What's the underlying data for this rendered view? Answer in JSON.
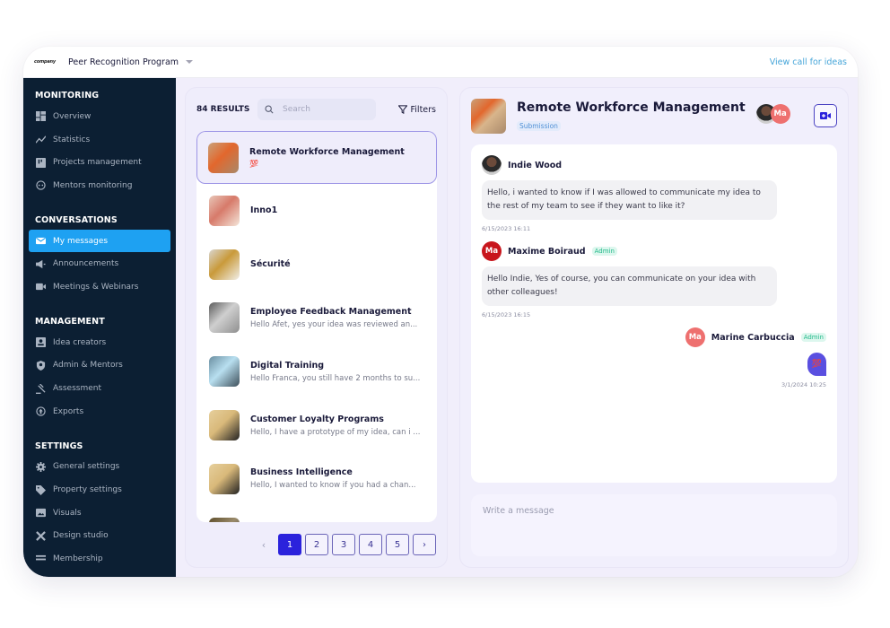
{
  "topbar": {
    "logo_text": "company",
    "program_name": "Peer Recognition Program",
    "view_call_link": "View call for ideas"
  },
  "sidebar": {
    "sections": [
      {
        "title": "MONITORING",
        "items": [
          {
            "label": "Overview",
            "icon": "dashboard-icon"
          },
          {
            "label": "Statistics",
            "icon": "chart-line-icon"
          },
          {
            "label": "Projects management",
            "icon": "kanban-icon"
          },
          {
            "label": "Mentors monitoring",
            "icon": "mentor-face-icon"
          }
        ]
      },
      {
        "title": "CONVERSATIONS",
        "items": [
          {
            "label": "My messages",
            "icon": "envelope-icon",
            "active": true
          },
          {
            "label": "Announcements",
            "icon": "megaphone-icon"
          },
          {
            "label": "Meetings & Webinars",
            "icon": "video-camera-icon"
          }
        ]
      },
      {
        "title": "MANAGEMENT",
        "items": [
          {
            "label": "Idea creators",
            "icon": "user-card-icon"
          },
          {
            "label": "Admin & Mentors",
            "icon": "shield-user-icon"
          },
          {
            "label": "Assessment",
            "icon": "gavel-icon"
          },
          {
            "label": "Exports",
            "icon": "export-circle-icon"
          }
        ]
      },
      {
        "title": "SETTINGS",
        "items": [
          {
            "label": "General settings",
            "icon": "gear-icon"
          },
          {
            "label": "Property settings",
            "icon": "tag-icon"
          },
          {
            "label": "Visuals",
            "icon": "image-icon"
          },
          {
            "label": "Design studio",
            "icon": "design-tools-icon"
          },
          {
            "label": "Membership",
            "icon": "list-icon"
          }
        ]
      }
    ]
  },
  "list_panel": {
    "results_count": "84 RESULTS",
    "search_placeholder": "Search",
    "filters_label": "Filters",
    "items": [
      {
        "title": "Remote Workforce Management",
        "preview": "",
        "badge": "💯",
        "selected": true,
        "thumb_colors": [
          "#c9a27a",
          "#e2672d",
          "#a9896a"
        ]
      },
      {
        "title": "Inno1",
        "preview": "",
        "thumb_colors": [
          "#e8c6b8",
          "#d77a6a",
          "#f4e6da"
        ]
      },
      {
        "title": "Sécurité",
        "preview": "",
        "thumb_colors": [
          "#d9d6cf",
          "#c99a3a",
          "#f1efe9"
        ]
      },
      {
        "title": "Employee Feedback Management",
        "preview": "Hello Afet, yes your idea was reviewed an...",
        "thumb_colors": [
          "#5b5b5b",
          "#cfcfcf",
          "#8f8f8f"
        ]
      },
      {
        "title": "Digital Training",
        "preview": "Hello Franca, you still have 2 months to su...",
        "thumb_colors": [
          "#6a8ea0",
          "#b8dff0",
          "#3e4f5a"
        ]
      },
      {
        "title": "Customer Loyalty Programs",
        "preview": "Hello, I have a prototype of my idea, can i ...",
        "thumb_colors": [
          "#e6cf9c",
          "#d9b97a",
          "#222222"
        ]
      },
      {
        "title": "Business Intelligence",
        "preview": "Hello, I wanted to know if you had a chan...",
        "thumb_colors": [
          "#e6cf9c",
          "#d9b97a",
          "#222222"
        ]
      },
      {
        "title": "",
        "preview": "",
        "thumb_colors": [
          "#5e4e2c",
          "#9a8a6a",
          "#2e2e2e"
        ]
      }
    ],
    "pagination": {
      "prev_label": "‹",
      "next_label": "›",
      "pages": [
        "1",
        "2",
        "3",
        "4",
        "5"
      ],
      "current": "1"
    }
  },
  "chat_panel": {
    "title": "Remote Workforce Management",
    "type_badge": "Submission",
    "participants": [
      {
        "type": "photo",
        "name": "Indie Wood"
      },
      {
        "type": "initials",
        "initials": "Ma"
      }
    ],
    "video_call_label": "Start video call",
    "messages": [
      {
        "author": "Indie Wood",
        "avatar": "photo",
        "role": "",
        "text": "Hello, i wanted to know if I was allowed to communicate my idea to the rest of my team to see if they want to like it?",
        "time": "6/15/2023 16:11",
        "align": "left"
      },
      {
        "author": "Maxime Boiraud",
        "avatar": "Ma",
        "role": "Admin",
        "text": "Hello Indie, Yes of course, you can communicate on your idea with other colleagues!",
        "time": "6/15/2023 16:15",
        "align": "left"
      },
      {
        "author": "Marine Carbuccia",
        "avatar": "Ma",
        "role": "Admin",
        "text": "💯",
        "time": "3/1/2024 10:25",
        "align": "right"
      }
    ],
    "composer_placeholder": "Write a message"
  },
  "colors": {
    "sidebar_bg": "#0c1f33",
    "active_nav": "#1ea1f2",
    "accent": "#2b22dc",
    "link": "#47a6d9",
    "admin_badge": "#23b98a",
    "avatar_red": "#c8161d",
    "avatar_salmon": "#ee706f"
  }
}
